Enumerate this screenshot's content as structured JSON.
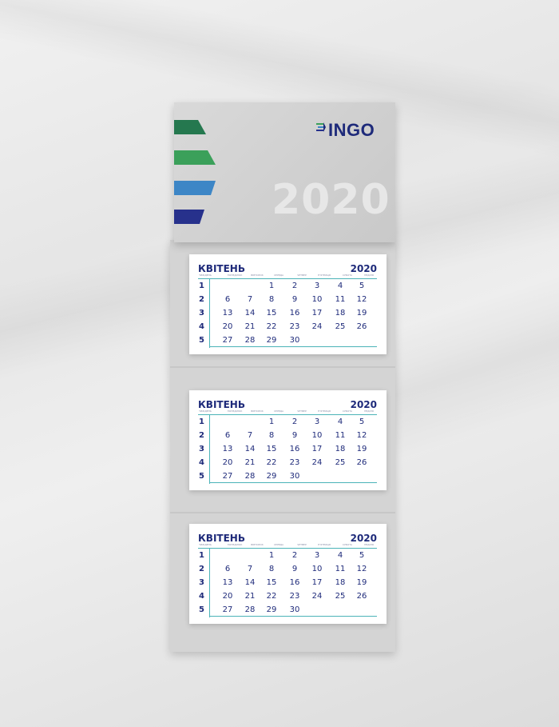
{
  "brand": {
    "name": "INGO",
    "year_big": "2020"
  },
  "colors": {
    "navy": "#1e2a7a",
    "teal_line": "#4bb3b8",
    "stripes": [
      "#25784f",
      "#3ba05a",
      "#3d86c6",
      "#27318c"
    ]
  },
  "calendars": [
    {
      "month": "КВІТЕНЬ",
      "year": "2020",
      "weekday_names": [
        "ТИЖДЕНЬ",
        "ПОНЕДІЛОК",
        "ВІВТОРОК",
        "СЕРЕДА",
        "ЧЕТВЕР",
        "П'ЯТНИЦЯ",
        "СУБОТА",
        "НЕДІЛЯ"
      ],
      "weeks": [
        {
          "num": "1",
          "days": [
            "",
            "",
            "1",
            "2",
            "3",
            "4",
            "5"
          ]
        },
        {
          "num": "2",
          "days": [
            "6",
            "7",
            "8",
            "9",
            "10",
            "11",
            "12"
          ]
        },
        {
          "num": "3",
          "days": [
            "13",
            "14",
            "15",
            "16",
            "17",
            "18",
            "19"
          ]
        },
        {
          "num": "4",
          "days": [
            "20",
            "21",
            "22",
            "23",
            "24",
            "25",
            "26"
          ]
        },
        {
          "num": "5",
          "days": [
            "27",
            "28",
            "29",
            "30",
            "",
            "",
            ""
          ]
        }
      ]
    },
    {
      "month": "КВІТЕНЬ",
      "year": "2020",
      "weekday_names": [
        "ТИЖДЕНЬ",
        "ПОНЕДІЛОК",
        "ВІВТОРОК",
        "СЕРЕДА",
        "ЧЕТВЕР",
        "П'ЯТНИЦЯ",
        "СУБОТА",
        "НЕДІЛЯ"
      ],
      "weeks": [
        {
          "num": "1",
          "days": [
            "",
            "",
            "1",
            "2",
            "3",
            "4",
            "5"
          ]
        },
        {
          "num": "2",
          "days": [
            "6",
            "7",
            "8",
            "9",
            "10",
            "11",
            "12"
          ]
        },
        {
          "num": "3",
          "days": [
            "13",
            "14",
            "15",
            "16",
            "17",
            "18",
            "19"
          ]
        },
        {
          "num": "4",
          "days": [
            "20",
            "21",
            "22",
            "23",
            "24",
            "25",
            "26"
          ]
        },
        {
          "num": "5",
          "days": [
            "27",
            "28",
            "29",
            "30",
            "",
            "",
            ""
          ]
        }
      ]
    },
    {
      "month": "КВІТЕНЬ",
      "year": "2020",
      "weekday_names": [
        "ТИЖДЕНЬ",
        "ПОНЕДІЛОК",
        "ВІВТОРОК",
        "СЕРЕДА",
        "ЧЕТВЕР",
        "П'ЯТНИЦЯ",
        "СУБОТА",
        "НЕДІЛЯ"
      ],
      "weeks": [
        {
          "num": "1",
          "days": [
            "",
            "",
            "1",
            "2",
            "3",
            "4",
            "5"
          ]
        },
        {
          "num": "2",
          "days": [
            "6",
            "7",
            "8",
            "9",
            "10",
            "11",
            "12"
          ]
        },
        {
          "num": "3",
          "days": [
            "13",
            "14",
            "15",
            "16",
            "17",
            "18",
            "19"
          ]
        },
        {
          "num": "4",
          "days": [
            "20",
            "21",
            "22",
            "23",
            "24",
            "25",
            "26"
          ]
        },
        {
          "num": "5",
          "days": [
            "27",
            "28",
            "29",
            "30",
            "",
            "",
            ""
          ]
        }
      ]
    }
  ]
}
